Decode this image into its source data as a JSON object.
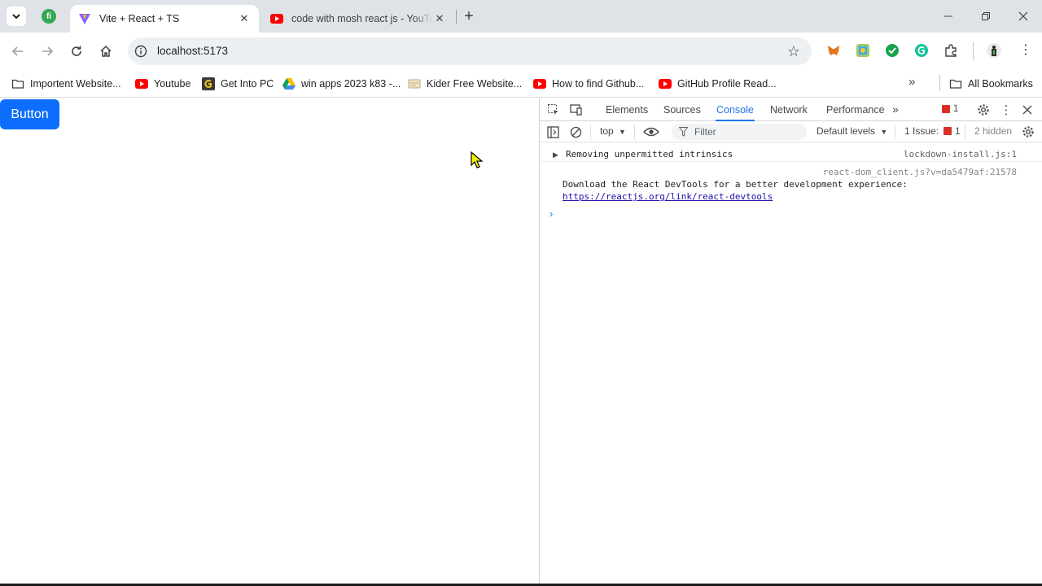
{
  "browser": {
    "tabs": [
      {
        "title": "Vite + React + TS",
        "active": true
      },
      {
        "title": "code with mosh react js - YouTube",
        "active": false
      }
    ],
    "address": "localhost:5173",
    "bookmarks": [
      {
        "label": "Importent Website...",
        "icon": "folder-icon"
      },
      {
        "label": "Youtube",
        "icon": "youtube-icon"
      },
      {
        "label": "Get Into PC",
        "icon": "getintopc-icon"
      },
      {
        "label": "win apps 2023 k83 -...",
        "icon": "google-drive-icon"
      },
      {
        "label": "Kider Free Website...",
        "icon": "page-icon"
      },
      {
        "label": "How to find Github...",
        "icon": "youtube-icon"
      },
      {
        "label": "GitHub Profile Read...",
        "icon": "youtube-icon"
      }
    ],
    "all_bookmarks": "All Bookmarks",
    "extensions": [
      "metamask-icon",
      "photo-ext-icon",
      "green-ext-icon",
      "grammarly-icon",
      "puzzle-icon"
    ]
  },
  "page": {
    "button_label": "Button"
  },
  "devtools": {
    "tabs": [
      "Elements",
      "Sources",
      "Console",
      "Network",
      "Performance"
    ],
    "active_tab": "Console",
    "error_count": "1",
    "context": "top",
    "filter_placeholder": "Filter",
    "levels": "Default levels",
    "issues": "1 Issue:",
    "issues_count": "1",
    "hidden": "2 hidden",
    "messages": [
      {
        "text": "Removing unpermitted intrinsics",
        "source": "lockdown-install.js:1"
      },
      {
        "text": "Download the React DevTools for a better development experience:",
        "source": "react-dom_client.js?v=da5479af:21578",
        "link": "https://reactjs.org/link/react-devtools"
      }
    ]
  },
  "colors": {
    "primary_button": "#0d6efd",
    "devtools_accent": "#1a73e8",
    "error": "#d93025"
  }
}
